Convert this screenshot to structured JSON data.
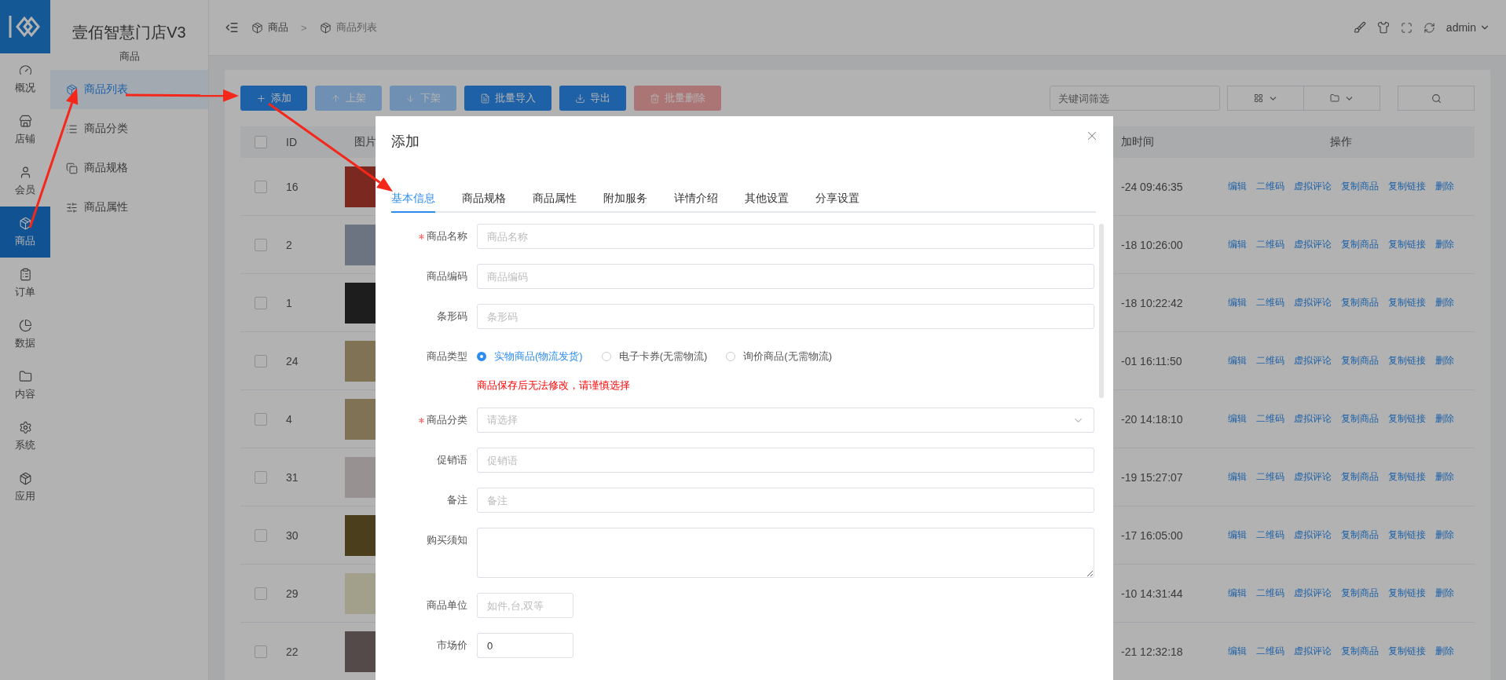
{
  "rail": {
    "items": [
      {
        "label": "概况",
        "selected": false
      },
      {
        "label": "店铺",
        "selected": false
      },
      {
        "label": "会员",
        "selected": false
      },
      {
        "label": "商品",
        "selected": true
      },
      {
        "label": "订单",
        "selected": false
      },
      {
        "label": "数据",
        "selected": false
      },
      {
        "label": "内容",
        "selected": false
      },
      {
        "label": "系统",
        "selected": false
      },
      {
        "label": "应用",
        "selected": false
      }
    ]
  },
  "sidebar": {
    "title": "壹佰智慧门店V3",
    "subtitle": "商品",
    "items": [
      {
        "label": "商品列表",
        "selected": true
      },
      {
        "label": "商品分类",
        "selected": false
      },
      {
        "label": "商品规格",
        "selected": false
      },
      {
        "label": "商品属性",
        "selected": false
      }
    ]
  },
  "header": {
    "breadcrumb": [
      "商品",
      "商品列表"
    ],
    "separator": ">",
    "user": "admin"
  },
  "toolbar": {
    "buttons": [
      {
        "label": "添加",
        "kind": "primary",
        "disabled": false
      },
      {
        "label": "上架",
        "kind": "primary",
        "disabled": true
      },
      {
        "label": "下架",
        "kind": "primary",
        "disabled": true
      },
      {
        "label": "批量导入",
        "kind": "primary",
        "disabled": false
      },
      {
        "label": "导出",
        "kind": "primary",
        "disabled": false
      },
      {
        "label": "批量删除",
        "kind": "danger",
        "disabled": true
      }
    ],
    "search": {
      "placeholder": "关键词筛选"
    }
  },
  "table": {
    "header_checked": false,
    "columns": [
      "ID",
      "图片",
      "加时间",
      "操作"
    ],
    "rows": [
      {
        "checked": false,
        "id": "16",
        "time": "-24 09:46:35",
        "actions": [
          "编辑",
          "二维码",
          "虚拟评论",
          "复制商品",
          "复制链接",
          "删除"
        ]
      },
      {
        "checked": false,
        "id": "2",
        "time": "-18 10:26:00",
        "actions": [
          "编辑",
          "二维码",
          "虚拟评论",
          "复制商品",
          "复制链接",
          "删除"
        ]
      },
      {
        "checked": false,
        "id": "1",
        "time": "-18 10:22:42",
        "actions": [
          "编辑",
          "二维码",
          "虚拟评论",
          "复制商品",
          "复制链接",
          "删除"
        ]
      },
      {
        "checked": false,
        "id": "24",
        "time": "-01 16:11:50",
        "actions": [
          "编辑",
          "二维码",
          "虚拟评论",
          "复制商品",
          "复制链接",
          "删除"
        ]
      },
      {
        "checked": false,
        "id": "4",
        "time": "-20 14:18:10",
        "actions": [
          "编辑",
          "二维码",
          "虚拟评论",
          "复制商品",
          "复制链接",
          "删除"
        ]
      },
      {
        "checked": false,
        "id": "31",
        "time": "-19 15:27:07",
        "actions": [
          "编辑",
          "二维码",
          "虚拟评论",
          "复制商品",
          "复制链接",
          "删除"
        ]
      },
      {
        "checked": false,
        "id": "30",
        "time": "-17 16:05:00",
        "actions": [
          "编辑",
          "二维码",
          "虚拟评论",
          "复制商品",
          "复制链接",
          "删除"
        ]
      },
      {
        "checked": false,
        "id": "29",
        "time": "-10 14:31:44",
        "actions": [
          "编辑",
          "二维码",
          "虚拟评论",
          "复制商品",
          "复制链接",
          "删除"
        ]
      },
      {
        "checked": false,
        "id": "22",
        "time": "-21 12:32:18",
        "actions": [
          "编辑",
          "二维码",
          "虚拟评论",
          "复制商品",
          "复制链接",
          "删除"
        ]
      }
    ]
  },
  "modal": {
    "title": "添加",
    "tabs": [
      {
        "label": "基本信息",
        "selected": true
      },
      {
        "label": "商品规格",
        "selected": false
      },
      {
        "label": "商品属性",
        "selected": false
      },
      {
        "label": "附加服务",
        "selected": false
      },
      {
        "label": "详情介绍",
        "selected": false
      },
      {
        "label": "其他设置",
        "selected": false
      },
      {
        "label": "分享设置",
        "selected": false
      }
    ],
    "fields": [
      {
        "kind": "text",
        "label": "商品名称",
        "required": true,
        "placeholder": "商品名称"
      },
      {
        "kind": "text",
        "label": "商品编码",
        "required": false,
        "placeholder": "商品编码"
      },
      {
        "kind": "text",
        "label": "条形码",
        "required": false,
        "placeholder": "条形码"
      },
      {
        "kind": "radio",
        "label": "商品类型",
        "required": false,
        "options": [
          {
            "label": "实物商品(物流发货)",
            "selected": true
          },
          {
            "label": "电子卡券(无需物流)",
            "selected": false
          },
          {
            "label": "询价商品(无需物流)",
            "selected": false
          }
        ],
        "note": "商品保存后无法修改，请谨慎选择"
      },
      {
        "kind": "select",
        "label": "商品分类",
        "required": true,
        "placeholder": "请选择"
      },
      {
        "kind": "text",
        "label": "促销语",
        "required": false,
        "placeholder": "促销语"
      },
      {
        "kind": "text",
        "label": "备注",
        "required": false,
        "placeholder": "备注"
      },
      {
        "kind": "textarea",
        "label": "购买须知",
        "required": false
      },
      {
        "kind": "short",
        "label": "商品单位",
        "required": false,
        "placeholder": "如件,台,双等"
      },
      {
        "kind": "short",
        "label": "市场价",
        "required": false,
        "value": "0"
      }
    ]
  }
}
